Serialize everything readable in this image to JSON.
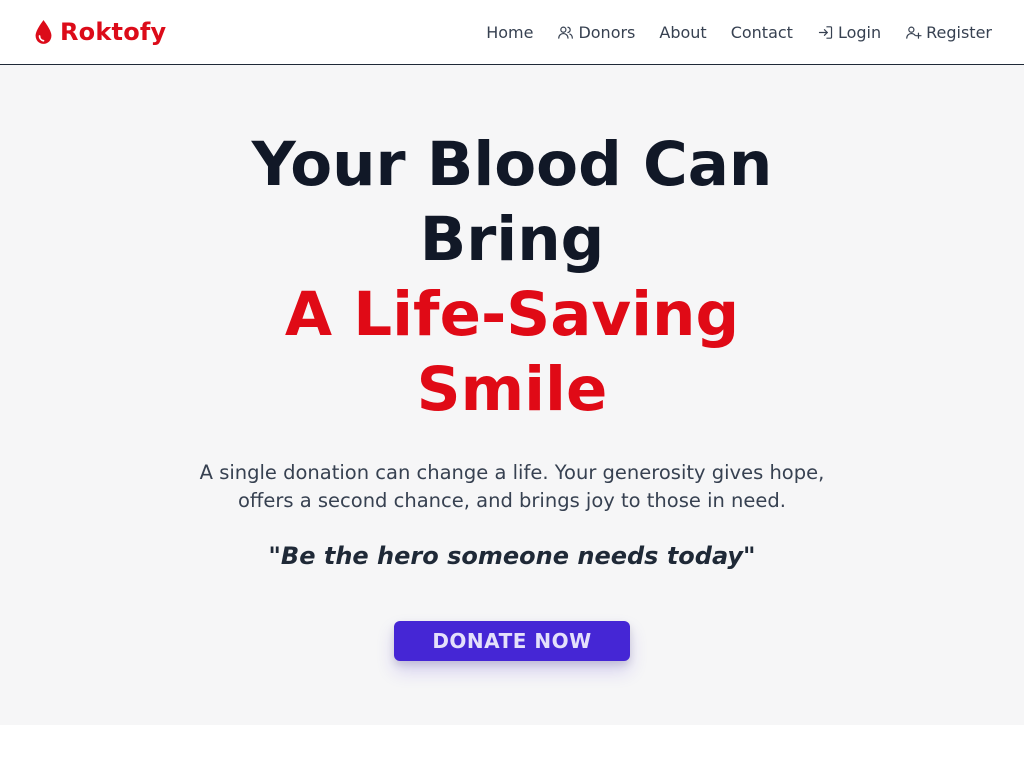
{
  "navbar": {
    "brand_name": "Roktofy",
    "brand_icon": "blood-drop-icon",
    "items": [
      {
        "label": "Home",
        "icon": ""
      },
      {
        "label": "Donors",
        "icon": "users-icon"
      },
      {
        "label": "About",
        "icon": ""
      },
      {
        "label": "Contact",
        "icon": ""
      },
      {
        "label": "Login",
        "icon": "login-icon"
      },
      {
        "label": "Register",
        "icon": "user-plus-icon"
      }
    ]
  },
  "hero": {
    "headline_line1": "Your Blood Can",
    "headline_line2": "Bring",
    "highlight_line1": "A Life-Saving",
    "highlight_line2": "Smile",
    "subtext": "A single donation can change a life. Your generosity gives hope, offers a second chance, and brings joy to those in need.",
    "quote": "\"Be the hero someone needs today\"",
    "cta_label": "DONATE NOW"
  },
  "colors": {
    "brand_red": "#dc0b19",
    "headline_dark": "#111827",
    "cta_purple": "#4526d5",
    "hero_background": "#f6f6f7"
  }
}
